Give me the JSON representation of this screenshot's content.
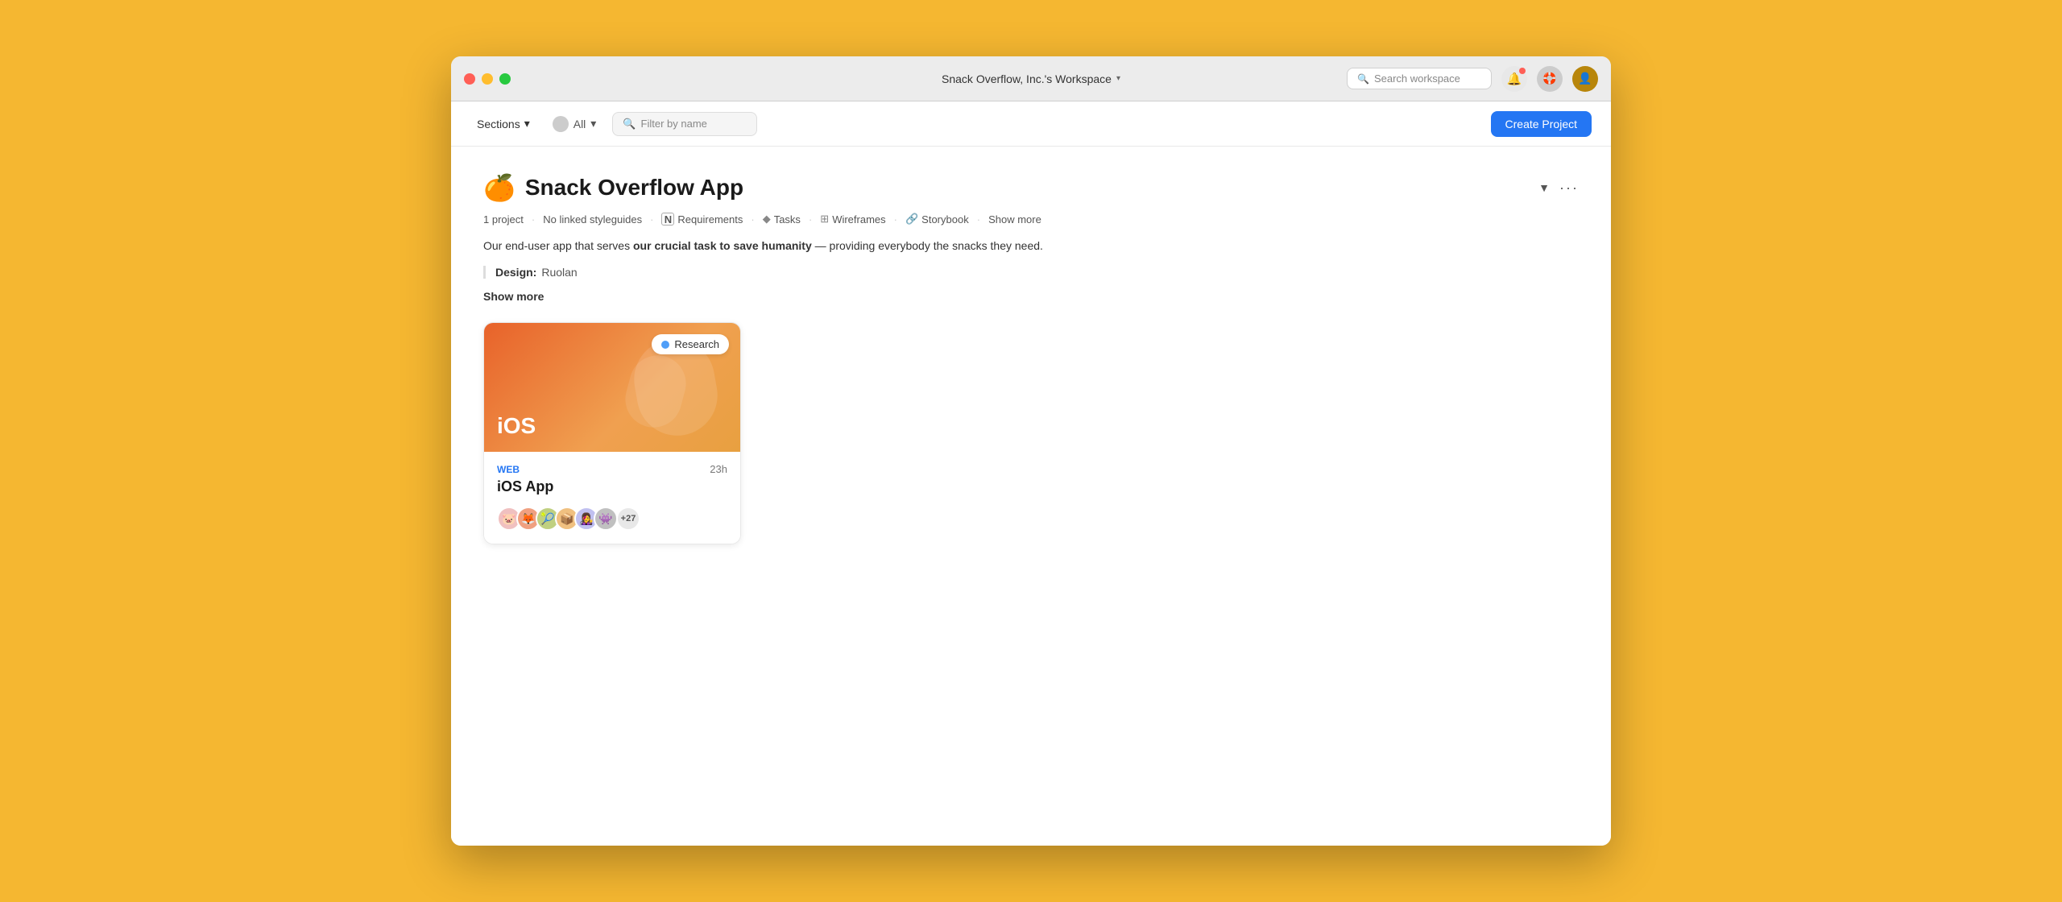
{
  "window": {
    "title": "Snack Overflow, Inc.'s Workspace",
    "title_chevron": "▾"
  },
  "titlebar": {
    "search_placeholder": "Search workspace",
    "traffic_lights": [
      "red",
      "yellow",
      "green"
    ]
  },
  "toolbar": {
    "sections_label": "Sections",
    "all_label": "All",
    "filter_placeholder": "Filter by name",
    "create_project_label": "Create Project"
  },
  "project": {
    "emoji": "🍊",
    "title": "Snack Overflow App",
    "meta": {
      "projects": "1 project",
      "styleguides": "No linked styleguides",
      "requirements_label": "Requirements",
      "tasks_label": "Tasks",
      "wireframes_label": "Wireframes",
      "storybook_label": "Storybook",
      "show_more_label": "Show more"
    },
    "description_text": "Our end-user app that serves ",
    "description_bold": "our crucial task to save humanity",
    "description_end": " — providing everybody the snacks they need.",
    "design_label": "Design:",
    "design_value": "Ruolan",
    "show_more": "Show more"
  },
  "card": {
    "banner_label": "iOS",
    "badge_label": "Research",
    "tag": "WEB",
    "hours": "23h",
    "name": "iOS App",
    "avatar_count": "+27",
    "avatars": [
      "🐷",
      "🦊",
      "🎾",
      "📦",
      "👩‍🎤",
      "👾"
    ]
  },
  "icons": {
    "search": "🔍",
    "chevron_down": "▾",
    "bell": "🔔",
    "help": "⊕",
    "more": "···",
    "notion": "N",
    "diamond": "◆",
    "grid": "⊞",
    "link": "🔗"
  },
  "colors": {
    "accent_blue": "#2476F3",
    "background_yellow": "#F5B731",
    "card_orange_start": "#E8622A",
    "card_orange_end": "#F0A050"
  }
}
